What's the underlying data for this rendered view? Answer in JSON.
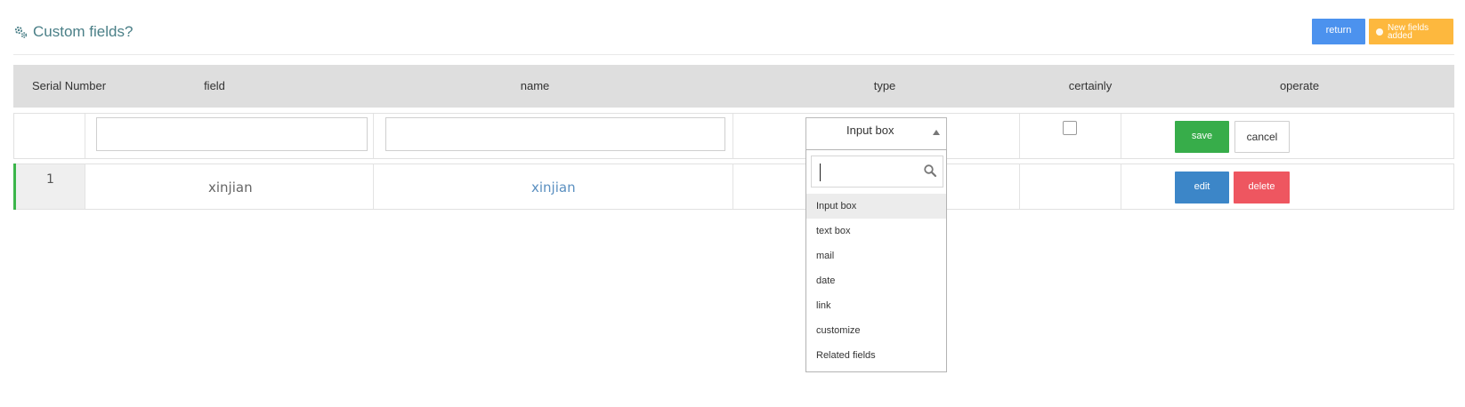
{
  "header": {
    "title": "Custom fields?",
    "return_label": "return",
    "new_label": "New fields added"
  },
  "table": {
    "columns": [
      "Serial Number",
      "field",
      "name",
      "type",
      "certainly",
      "operate"
    ],
    "edit_row": {
      "field_value": "",
      "name_value": "",
      "type_selected": "Input box",
      "certainly_checked": false,
      "save_label": "save",
      "cancel_label": "cancel"
    },
    "rows": [
      {
        "serial": "1",
        "field": "xinjian",
        "name": "xinjian",
        "edit_label": "edit",
        "delete_label": "delete"
      }
    ]
  },
  "type_dropdown": {
    "search_value": "",
    "options": [
      "Input box",
      "text box",
      "mail",
      "date",
      "link",
      "customize",
      "Related fields"
    ],
    "highlighted": "Input box"
  },
  "colors": {
    "title": "#4a7f87",
    "return": "#4c92ee",
    "new": "#fdb83e",
    "save": "#37ad4a",
    "edit": "#3c86c8",
    "delete": "#ee5660",
    "row_accent": "#3bb54a"
  }
}
